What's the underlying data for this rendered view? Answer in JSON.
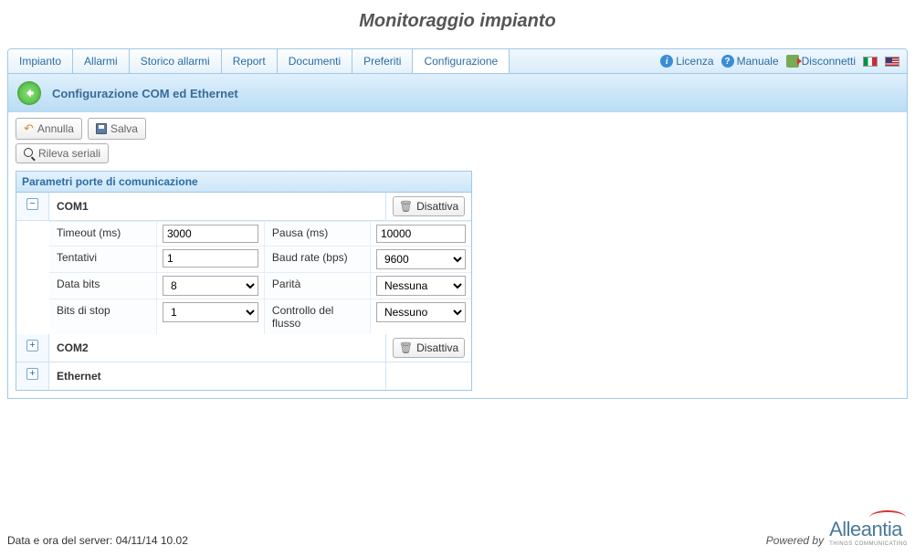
{
  "page": {
    "title": "Monitoraggio impianto"
  },
  "tabs": {
    "items": [
      "Impianto",
      "Allarmi",
      "Storico allarmi",
      "Report",
      "Documenti",
      "Preferiti",
      "Configurazione"
    ],
    "active_index": 6
  },
  "rightlinks": {
    "license": "Licenza",
    "manual": "Manuale",
    "disconnect": "Disconnetti"
  },
  "header": {
    "title": "Configurazione COM ed Ethernet"
  },
  "toolbar": {
    "cancel_label": "Annulla",
    "save_label": "Salva",
    "detect_label": "Rileva seriali"
  },
  "panel": {
    "title": "Parametri porte di comunicazione",
    "disable_label": "Disattiva",
    "ports": [
      {
        "name": "COM1",
        "expanded": true,
        "has_disable": true,
        "props": {
          "timeout_label": "Timeout (ms)",
          "timeout_value": "3000",
          "pause_label": "Pausa (ms)",
          "pause_value": "10000",
          "retries_label": "Tentativi",
          "retries_value": "1",
          "baud_label": "Baud rate (bps)",
          "baud_value": "9600",
          "databits_label": "Data bits",
          "databits_value": "8",
          "parity_label": "Parità",
          "parity_value": "Nessuna",
          "stopbits_label": "Bits di stop",
          "stopbits_value": "1",
          "flow_label": "Controllo del flusso",
          "flow_value": "Nessuno"
        }
      },
      {
        "name": "COM2",
        "expanded": false,
        "has_disable": true
      },
      {
        "name": "Ethernet",
        "expanded": false,
        "has_disable": false
      }
    ]
  },
  "footer": {
    "datetime_label": "Data e ora del server: 04/11/14 10.02",
    "powered_by": "Powered by",
    "logo_text": "Alleantia",
    "logo_sub": "THINGS COMMUNICATING"
  }
}
